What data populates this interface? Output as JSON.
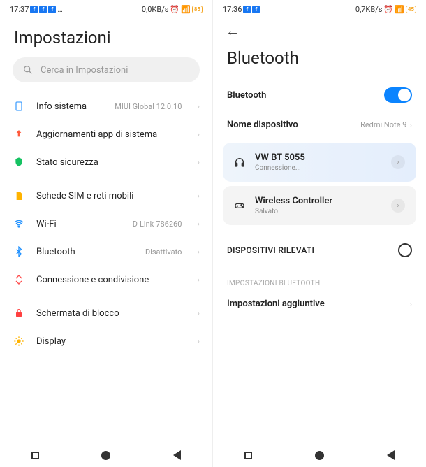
{
  "left": {
    "status": {
      "time": "17:37",
      "right": "0,0KB/s",
      "batt": "85"
    },
    "title": "Impostazioni",
    "search_placeholder": "Cerca in Impostazioni",
    "rows": {
      "info": {
        "label": "Info sistema",
        "value": "MIUI Global 12.0.10"
      },
      "updates": {
        "label": "Aggiornamenti app di sistema"
      },
      "security": {
        "label": "Stato sicurezza"
      },
      "sim": {
        "label": "Schede SIM e reti mobili"
      },
      "wifi": {
        "label": "Wi-Fi",
        "value": "D-Link-786260"
      },
      "bluetooth": {
        "label": "Bluetooth",
        "value": "Disattivato"
      },
      "connection": {
        "label": "Connessione e condivisione"
      },
      "lock": {
        "label": "Schermata di blocco"
      },
      "display": {
        "label": "Display"
      }
    }
  },
  "right": {
    "status": {
      "time": "17:36",
      "right": "0,7KB/s",
      "batt": "45"
    },
    "title": "Bluetooth",
    "toggle_label": "Bluetooth",
    "device_name_label": "Nome dispositivo",
    "device_name_value": "Redmi Note 9",
    "devices": {
      "headset": {
        "name": "VW BT 5055",
        "status": "Connessione..."
      },
      "controller": {
        "name": "Wireless Controller",
        "status": "Salvato"
      }
    },
    "discovered_header": "DISPOSITIVI RILEVATI",
    "settings_caption": "IMPOSTAZIONI BLUETOOTH",
    "additional": "Impostazioni aggiuntive"
  }
}
